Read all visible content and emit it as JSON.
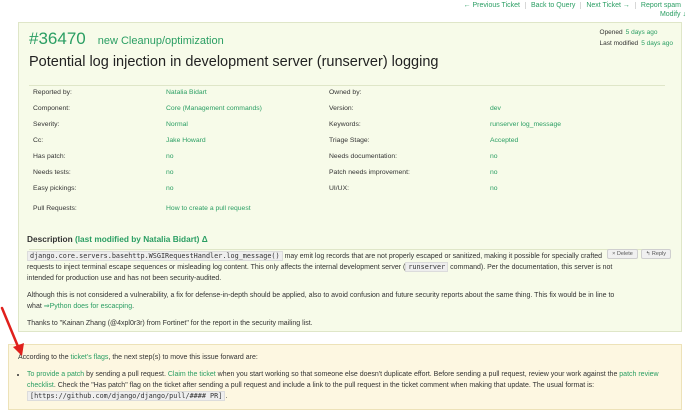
{
  "nav": {
    "previous": "← Previous Ticket",
    "back": "Back to Query",
    "next": "Next Ticket →",
    "report": "Report spam",
    "modify": "Modify ↓"
  },
  "ticket": {
    "number": "#36470",
    "type": "new Cleanup/optimization",
    "opened_label": "Opened",
    "opened_value": "5 days ago",
    "modified_label": "Last modified",
    "modified_value": "5 days ago",
    "title": "Potential log injection in development server (runserver) logging"
  },
  "props": [
    {
      "l1": "Reported by:",
      "v1": "Natalia Bidart",
      "l2": "Owned by:",
      "v2": ""
    },
    {
      "l1": "Component:",
      "v1": "Core (Management commands)",
      "l2": "Version:",
      "v2": "dev"
    },
    {
      "l1": "Severity:",
      "v1": "Normal",
      "l2": "Keywords:",
      "v2": "runserver log_message"
    },
    {
      "l1": "Cc:",
      "v1": "Jake Howard",
      "l2": "Triage Stage:",
      "v2": "Accepted"
    },
    {
      "l1": "Has patch:",
      "v1": "no",
      "l2": "Needs documentation:",
      "v2": "no"
    },
    {
      "l1": "Needs tests:",
      "v1": "no",
      "l2": "Patch needs improvement:",
      "v2": "no"
    },
    {
      "l1": "Easy pickings:",
      "v1": "no",
      "l2": "UI/UX:",
      "v2": "no"
    },
    {
      "l1": "Pull Requests:",
      "v1": "How to create a pull request",
      "l2": "",
      "v2": ""
    }
  ],
  "description": {
    "heading": "Description",
    "modified": "(last modified by Natalia Bidart) Δ",
    "delete_btn": "× Delete",
    "reply_btn": "↰ Reply",
    "p1_code1": "django.core.servers.basehttp.WSGIRequestHandler.log_message()",
    "p1_text1": " may emit log records that are not properly escaped or sanitized, making it possible for specially crafted requests to inject terminal escape sequences or misleading log content. This only affects the internal development server (",
    "p1_code2": "runserver",
    "p1_text2": " command). Per the documentation, this server is not intended for production use and has not been security-audited.",
    "p2_text": "Although this is not considered a vulnerability, a fix for defense-in-depth should be applied, also to avoid confusion and future security reports about the same thing. This fix would be in line to what ",
    "p2_link": "⇒Python does for escacping",
    "p2_end": ".",
    "p3": "Thanks to \"Kainan Zhang (@4xpl0r3r) from Fortinet\" for the report in the security mailing list."
  },
  "next_steps": {
    "intro_a": "According to the ",
    "intro_link": "ticket's flags",
    "intro_b": ", the next step(s) to move this issue forward are:",
    "link1": "To provide a patch",
    "t1": " by sending a pull request. ",
    "link2": "Claim the ticket",
    "t2": " when you start working so that someone else doesn't duplicate effort. Before sending a pull request, review your work against the ",
    "link3": "patch review checklist",
    "t3": ". Check the \"Has patch\" flag on the ticket after sending a pull request and include a link to the pull request in the ticket comment when making that update. The usual format is: ",
    "code": "[https://github.com/django/django/pull/#### PR]",
    "t4": "."
  },
  "colors": {
    "link": "#2a9e63",
    "ticket_bg": "#f7fbe9",
    "next_bg": "#fdf7e1",
    "arrow": "#e0201c"
  }
}
